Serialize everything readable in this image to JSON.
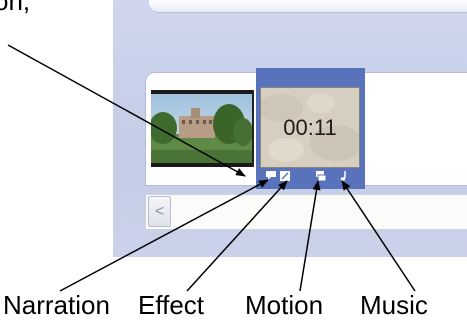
{
  "caption": {
    "partial_text": "on,"
  },
  "timeline": {
    "clip2": {
      "duration": "00:11"
    },
    "indicators": [
      {
        "icon": "narration-icon"
      },
      {
        "icon": "effect-icon"
      },
      {
        "icon": "motion-icon"
      },
      {
        "icon": "music-icon"
      }
    ],
    "scroll_left_glyph": "<"
  },
  "labels": {
    "narration": "Narration",
    "effect": "Effect",
    "motion": "Motion",
    "music": "Music"
  },
  "colors": {
    "panel_bg": "#cbd2ea",
    "selection_frame": "#5872bb",
    "indicator_fg": "#ffffff"
  }
}
